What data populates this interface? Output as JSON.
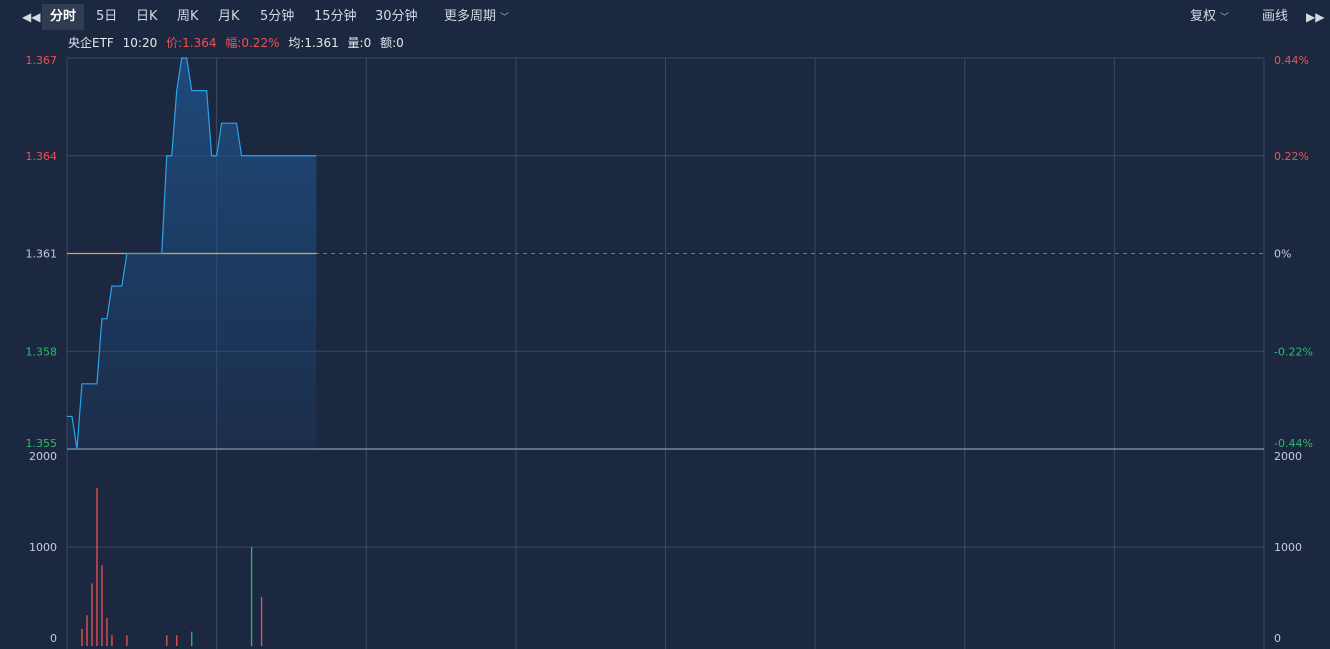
{
  "toolbar": {
    "tabs": [
      {
        "label": "分时",
        "active": true
      },
      {
        "label": "5日"
      },
      {
        "label": "日K"
      },
      {
        "label": "周K"
      },
      {
        "label": "月K"
      },
      {
        "label": "5分钟"
      },
      {
        "label": "15分钟"
      },
      {
        "label": "30分钟"
      },
      {
        "label": "更多周期"
      }
    ],
    "right": {
      "fuquan": "复权",
      "draw": "画线"
    }
  },
  "info": {
    "name": "央企ETF",
    "time": "10:20",
    "price": "价:1.364",
    "change": "幅:0.22%",
    "avg": "均:1.361",
    "volume": "量:0",
    "amount": "额:0"
  },
  "colors": {
    "background": "#1b2840",
    "price_line": "#2aa3e8",
    "avg_line": "#e6a23c",
    "up": "#f05050",
    "down": "#2fb86b",
    "grid": "#3a4a63",
    "neutral_text": "#c8cdd6"
  },
  "chart_data": [
    {
      "type": "line",
      "name": "price",
      "y_ticks": [
        "1.367",
        "1.364",
        "1.361",
        "1.358",
        "1.355"
      ],
      "right_ticks": [
        "0.44%",
        "0.22%",
        "0%",
        "-0.22%",
        "-0.44%"
      ],
      "ylim": [
        1.355,
        1.367
      ],
      "prev_close": 1.361,
      "total_minutes": 240,
      "x": [
        0,
        1,
        2,
        3,
        4,
        5,
        6,
        7,
        8,
        9,
        10,
        11,
        12,
        13,
        14,
        15,
        16,
        17,
        18,
        19,
        20,
        21,
        22,
        23,
        24,
        25,
        26,
        27,
        28,
        29,
        30,
        31,
        32,
        33,
        34,
        35,
        36,
        37,
        38,
        39,
        40,
        41,
        42,
        43,
        44,
        45,
        46,
        47,
        48,
        49,
        50
      ],
      "values": [
        1.356,
        1.356,
        1.355,
        1.357,
        1.357,
        1.357,
        1.357,
        1.359,
        1.359,
        1.36,
        1.36,
        1.36,
        1.361,
        1.361,
        1.361,
        1.361,
        1.361,
        1.361,
        1.361,
        1.361,
        1.364,
        1.364,
        1.366,
        1.367,
        1.367,
        1.366,
        1.366,
        1.366,
        1.366,
        1.364,
        1.364,
        1.365,
        1.365,
        1.365,
        1.365,
        1.364,
        1.364,
        1.364,
        1.364,
        1.364,
        1.364,
        1.364,
        1.364,
        1.364,
        1.364,
        1.364,
        1.364,
        1.364,
        1.364,
        1.364,
        1.364
      ],
      "avg_values": [
        1.361,
        1.361,
        1.361,
        1.361,
        1.361,
        1.361,
        1.361,
        1.361,
        1.361,
        1.361,
        1.361,
        1.361,
        1.361,
        1.361,
        1.361,
        1.361,
        1.361,
        1.361,
        1.361,
        1.361,
        1.361,
        1.361,
        1.361,
        1.361,
        1.361,
        1.361,
        1.361,
        1.361,
        1.361,
        1.361,
        1.361,
        1.361,
        1.361,
        1.361,
        1.361,
        1.361,
        1.361,
        1.361,
        1.361,
        1.361,
        1.361,
        1.361,
        1.361,
        1.361,
        1.361,
        1.361,
        1.361,
        1.361,
        1.361,
        1.361,
        1.361
      ]
    },
    {
      "type": "bar",
      "name": "volume",
      "y_ticks": [
        "2000",
        "1000",
        "0"
      ],
      "ylim": [
        0,
        2000
      ],
      "x": [
        3,
        4,
        5,
        6,
        7,
        8,
        9,
        12,
        20,
        22,
        25,
        37,
        39
      ],
      "values": [
        100,
        250,
        600,
        1650,
        800,
        220,
        30,
        30,
        30,
        30,
        70,
        1000,
        450
      ],
      "direction": [
        "up",
        "up",
        "up",
        "up",
        "up",
        "up",
        "up",
        "up",
        "up",
        "up",
        "down",
        "down",
        "up"
      ]
    }
  ]
}
